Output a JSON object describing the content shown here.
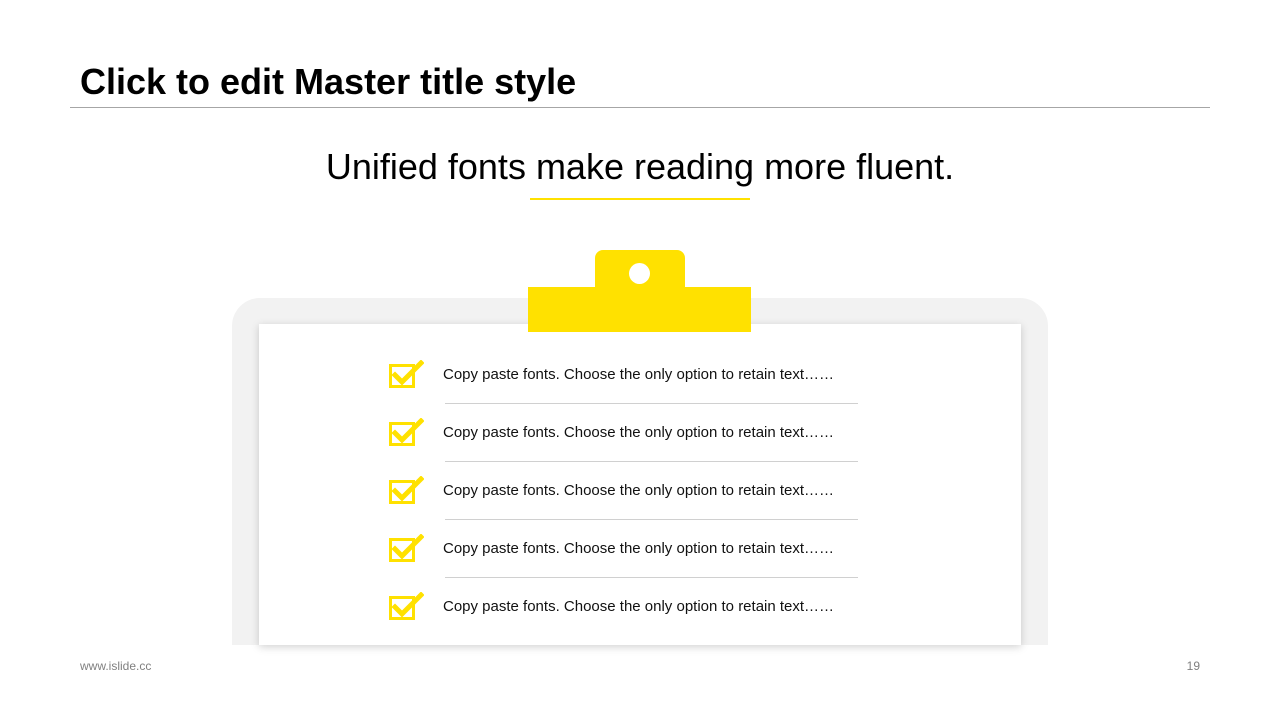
{
  "slide": {
    "master_title": "Click to edit Master title style",
    "headline": "Unified fonts make reading more fluent.",
    "accent_color": "#ffe100"
  },
  "checklist": {
    "icon": "checked-box-icon",
    "items": [
      {
        "text": "Copy paste fonts. Choose the only option to retain text……"
      },
      {
        "text": "Copy paste fonts. Choose the only option to retain text……"
      },
      {
        "text": "Copy paste fonts. Choose the only option to retain text……"
      },
      {
        "text": "Copy paste fonts. Choose the only option to retain text……"
      },
      {
        "text": "Copy paste fonts. Choose the only option to retain text……"
      }
    ]
  },
  "footer": {
    "url": "www.islide.cc",
    "page_number": "19"
  }
}
